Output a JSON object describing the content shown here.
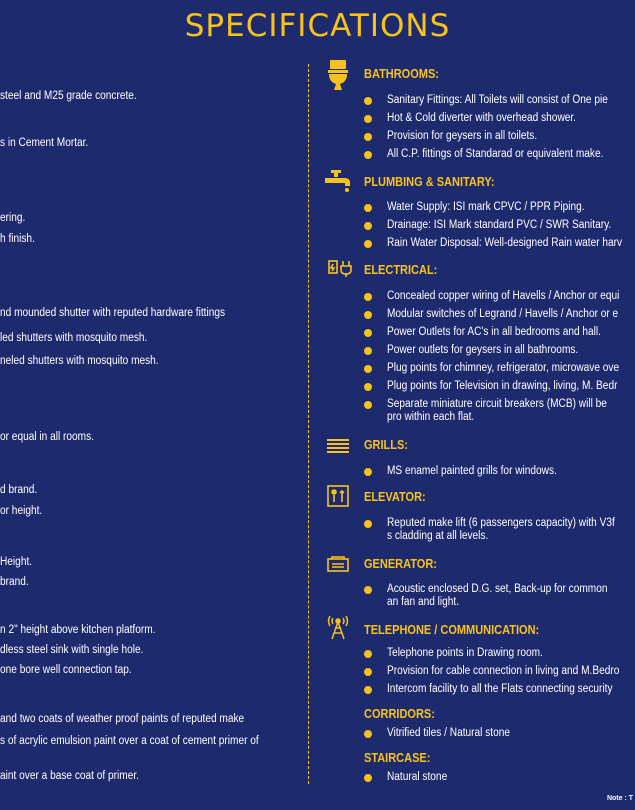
{
  "title": "SPECIFICATIONS",
  "left_lines": [
    "steel and M25 grade concrete.",
    "s in Cement Mortar.",
    "ering.",
    "h finish.",
    "nd mounded shutter with reputed hardware fittings",
    "led shutters with mosquito mesh.",
    "neled shutters with mosquito mesh.",
    "or equal in all rooms.",
    "d brand.",
    "or height.",
    "Height.",
    "brand.",
    "n 2\" height above kitchen platform.",
    "dless steel sink with single hole.",
    " one bore well connection tap.",
    " and two coats of weather proof paints of reputed make",
    "s of acrylic emulsion paint over a coat of cement primer of",
    "aint over a base coat of primer."
  ],
  "sections": {
    "bathrooms": {
      "title": "BATHROOMS:",
      "icon": "toilet-icon",
      "items": [
        "Sanitary Fittings: All Toilets will consist of One pie",
        "Hot & Cold diverter with overhead shower.",
        "Provision for geysers in all toilets.",
        "All C.P. fittings of Standarad or equivalent make."
      ]
    },
    "plumbing": {
      "title": "PLUMBING & SANITARY:",
      "icon": "faucet-icon",
      "items": [
        "Water Supply: ISI mark CPVC / PPR Piping.",
        "Drainage: ISI Mark standard PVC / SWR Sanitary.",
        "Rain Water Disposal: Well-designed Rain water harv"
      ]
    },
    "electrical": {
      "title": "ELECTRICAL:",
      "icon": "electrical-icon",
      "items": [
        "Concealed copper wiring of Havells / Anchor or equi",
        "Modular switches of Legrand / Havells / Anchor or e",
        "Power Outlets for AC's in all bedrooms and hall.",
        "Power outlets for geysers in all bathrooms.",
        "Plug points for chimney, refrigerator, microwave ove",
        "Plug points for Television in drawing, living, M. Bedr",
        "Separate miniature circuit breakers (MCB) will be pro within each flat."
      ]
    },
    "grills": {
      "title": "GRILLS:",
      "icon": "grill-icon",
      "items": [
        "MS enamel painted grills for windows."
      ]
    },
    "elevator": {
      "title": "ELEVATOR:",
      "icon": "elevator-icon",
      "items": [
        "Reputed make lift (6 passengers capacity) with V3f s cladding at all levels."
      ]
    },
    "generator": {
      "title": "GENERATOR:",
      "icon": "generator-icon",
      "items": [
        "Acoustic enclosed D.G. set, Back-up for common an fan and light."
      ]
    },
    "telephone": {
      "title": "TELEPHONE / COMMUNICATION:",
      "icon": "telephone-tower-icon",
      "items": [
        "Telephone points in Drawing room.",
        "Provision for cable connection in living and M.Bedro",
        "Intercom facility to all the Flats connecting security"
      ]
    },
    "corridors": {
      "title": "CORRIDORS:",
      "items": [
        "Vitrified tiles / Natural stone"
      ]
    },
    "staircase": {
      "title": "STAIRCASE:",
      "items": [
        "Natural stone"
      ]
    }
  },
  "note": "Note : T",
  "colors": {
    "background": "#1e2a6e",
    "accent": "#f7c21b",
    "text": "#ffffff"
  }
}
